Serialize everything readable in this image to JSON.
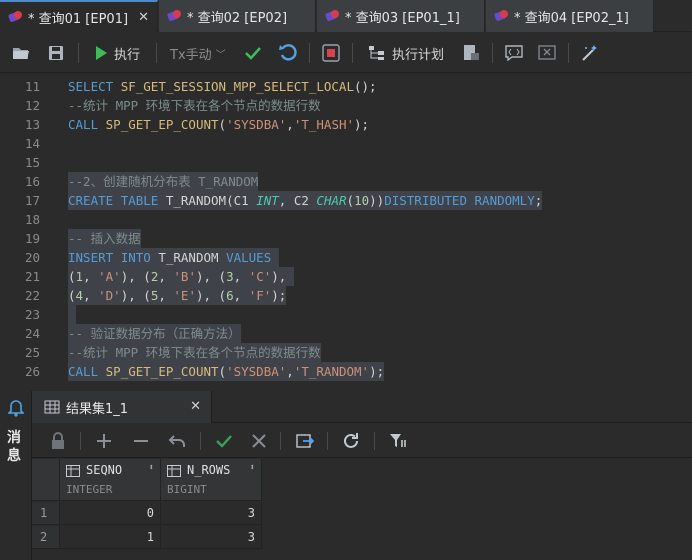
{
  "tabs": [
    {
      "label": "* 查询01 [EP01]",
      "active": true
    },
    {
      "label": "* 查询02 [EP02]",
      "active": false
    },
    {
      "label": "* 查询03 [EP01_1]",
      "active": false
    },
    {
      "label": "* 查询04 [EP02_1]",
      "active": false
    }
  ],
  "toolbar": {
    "run_label": "执行",
    "tx_mode_label": "Tx手动",
    "plan_label": "执行计划"
  },
  "editor": {
    "lines": [
      {
        "no": "11"
      },
      {
        "no": "12"
      },
      {
        "no": "13"
      },
      {
        "no": "14"
      },
      {
        "no": "15"
      },
      {
        "no": "16"
      },
      {
        "no": "17"
      },
      {
        "no": "18"
      },
      {
        "no": "19"
      },
      {
        "no": "20"
      },
      {
        "no": "21"
      },
      {
        "no": "22"
      },
      {
        "no": "23"
      },
      {
        "no": "24"
      },
      {
        "no": "25"
      },
      {
        "no": "26"
      }
    ],
    "tokens": {
      "l11": [
        "SELECT",
        "SF_GET_SESSION_MPP_SELECT_LOCAL",
        "();"
      ],
      "l12": "--统计 MPP 环境下表在各个节点的数据行数",
      "l13": [
        "CALL",
        "SP_GET_EP_COUNT",
        "(",
        "'SYSDBA'",
        ",",
        "'T_HASH'",
        ");"
      ],
      "l16": "--2、创建随机分布表 T_RANDOM",
      "l17": [
        "CREATE",
        "TABLE",
        "T_RANDOM",
        "(C1",
        "INT",
        ",",
        "C2",
        "CHAR",
        "(",
        "10",
        "))",
        "DISTRIBUTED",
        "RANDOMLY",
        ";"
      ],
      "l19": "-- 插入数据",
      "l20": [
        "INSERT",
        "INTO",
        "T_RANDOM",
        "VALUES"
      ],
      "l21": [
        "(",
        "1",
        ", ",
        "'A'",
        "), (",
        "2",
        ", ",
        "'B'",
        "), (",
        "3",
        ", ",
        "'C'",
        "),"
      ],
      "l22": [
        "(",
        "4",
        ", ",
        "'D'",
        "), (",
        "5",
        ", ",
        "'E'",
        "), (",
        "6",
        ", ",
        "'F'",
        ");"
      ],
      "l24": "-- 验证数据分布（正确方法）",
      "l25": "--统计 MPP 环境下表在各个节点的数据行数",
      "l26": [
        "CALL",
        "SP_GET_EP_COUNT",
        "(",
        "'SYSDBA'",
        ",",
        "'T_RANDOM'",
        ");"
      ]
    }
  },
  "side_panel": {
    "label_line1": "消",
    "label_line2": "息"
  },
  "result": {
    "tab_label": "结果集1_1",
    "columns": [
      {
        "name": "SEQNO",
        "type": "INTEGER"
      },
      {
        "name": "N_ROWS",
        "type": "BIGINT"
      }
    ],
    "rows": [
      {
        "num": "1",
        "cells": [
          "0",
          "3"
        ]
      },
      {
        "num": "2",
        "cells": [
          "1",
          "3"
        ]
      }
    ]
  },
  "colors": {
    "keyword": "#569cd6",
    "function": "#d7ba7d",
    "string": "#ce9178",
    "comment": "#7f8c8d",
    "accent_green": "#3dbb5c",
    "accent_blue": "#4f89c9"
  },
  "icons": [
    "query-tab-icon",
    "close-icon",
    "open-folder-icon",
    "save-icon",
    "run-icon",
    "chevron-down-icon",
    "commit-icon",
    "rollback-icon",
    "stop-icon",
    "explain-plan-icon",
    "export-icon",
    "comment-icon",
    "uncomment-icon",
    "format-icon",
    "message-bell-icon",
    "grid-icon",
    "lock-icon",
    "add-row-icon",
    "delete-row-icon",
    "undo-icon",
    "apply-icon",
    "cancel-icon",
    "export-result-icon",
    "refresh-icon",
    "filter-icon"
  ]
}
